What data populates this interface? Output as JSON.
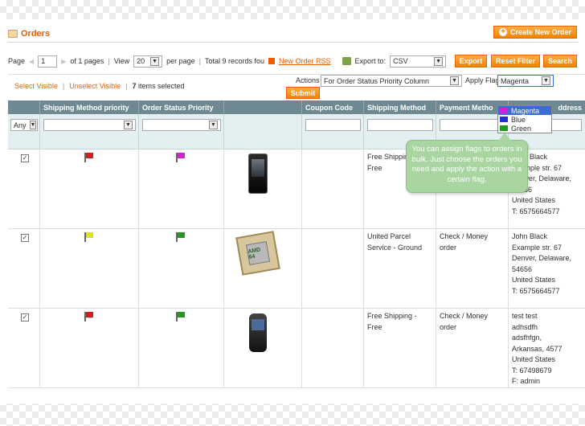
{
  "header": {
    "title": "Orders",
    "create_label": "Create New Order"
  },
  "pager": {
    "page_label": "Page",
    "page_value": "1",
    "of_pages": "of 1 pages",
    "view_label": "View",
    "view_value": "20",
    "per_page": "per page",
    "total": "Total 9 records fou",
    "rss": "New Order RSS",
    "export_label": "Export to:",
    "export_value": "CSV",
    "export_btn": "Export",
    "reset_btn": "Reset Filter",
    "search_btn": "Search"
  },
  "massaction": {
    "select_visible": "Select Visible",
    "sep": "|",
    "unselect_visible": "Unselect Visible",
    "selected_count": "7",
    "selected_label": "items selected",
    "actions_label": "Actions",
    "actions_value": "For Order Status Priority Column",
    "submit": "Submit",
    "apply_flag_label": "Apply Flag",
    "flag_value": "Magenta"
  },
  "flag_options": [
    {
      "label": "Magenta",
      "color": "#d31fd3"
    },
    {
      "label": "Blue",
      "color": "#1f2fd3"
    },
    {
      "label": "Green",
      "color": "#1f9a1f"
    }
  ],
  "columns": {
    "shipping_priority": "Shipping Method priority",
    "status_priority": "Order Status Priority",
    "coupon": "Coupon Code",
    "shipping_method": "Shipping Method",
    "payment_method": "Payment Metho",
    "address": "ddress"
  },
  "filter": {
    "any": "Any"
  },
  "rows": [
    {
      "flag1": "#d22020",
      "flag2": "#d320d3",
      "product": "phone-image",
      "shipping": [
        "Free Shipping",
        "Free"
      ],
      "payment": [
        "",
        ""
      ],
      "address": [
        "John Black",
        "Example str. 67",
        "Denver, Delaware,",
        "54656",
        "United States",
        "T: 6575664577"
      ]
    },
    {
      "flag1": "#e0e020",
      "flag2": "#1f9a1f",
      "product": "cpu-image",
      "shipping": [
        "United Parcel",
        "Service - Ground"
      ],
      "payment": [
        "Check / Money",
        "order"
      ],
      "address": [
        "John Black",
        "Example str. 67",
        "Denver, Delaware,",
        "54656",
        "United States",
        "T: 6575664577"
      ]
    },
    {
      "flag1": "#d22020",
      "flag2": "#1f9a1f",
      "product": "mobile-image",
      "shipping": [
        "Free Shipping -",
        "Free"
      ],
      "payment": [
        "Check / Money",
        "order"
      ],
      "address": [
        "test test",
        "adhsdfh",
        "adsfhfgn,",
        "Arkansas, 4577",
        "United States",
        "T: 67498679",
        "F: admin"
      ]
    }
  ],
  "tooltip": "You can assign flags to orders in bulk. Just choose the orders you need and apply the action with a certain flag."
}
